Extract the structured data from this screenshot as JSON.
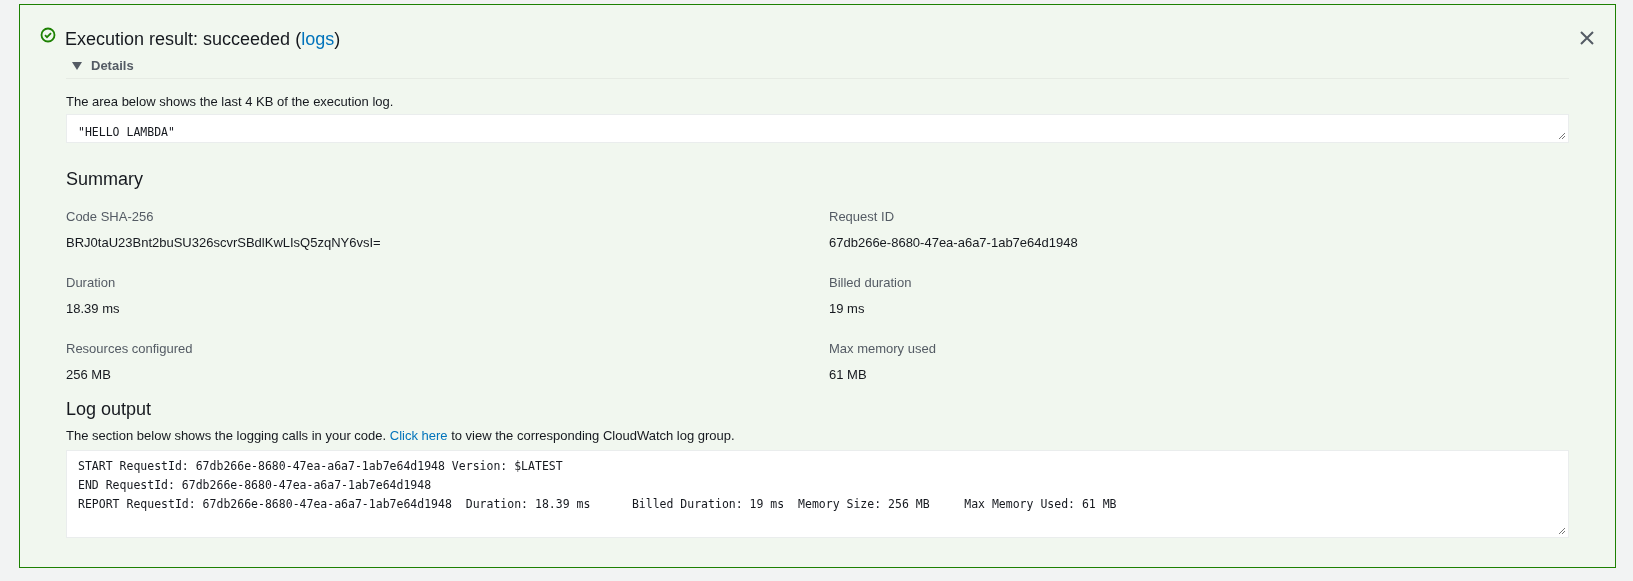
{
  "result": {
    "kind": "success",
    "title_prefix": "Execution result: succeeded (",
    "link": "logs",
    "title_suffix": ")"
  },
  "details": {
    "label": "Details",
    "expanded": true,
    "description": "The area below shows the last 4 KB of the execution log.",
    "output": "\"HELLO LAMBDA\""
  },
  "summary": {
    "heading": "Summary",
    "items": [
      {
        "label": "Code SHA-256",
        "value": "BRJ0taU23Bnt2buSU326scvrSBdlKwLIsQ5zqNY6vsI="
      },
      {
        "label": "Request ID",
        "value": "67db266e-8680-47ea-a6a7-1ab7e64d1948"
      },
      {
        "label": "Duration",
        "value": "18.39 ms"
      },
      {
        "label": "Billed duration",
        "value": "19 ms"
      },
      {
        "label": "Resources configured",
        "value": "256 MB"
      },
      {
        "label": "Max memory used",
        "value": "61 MB"
      }
    ]
  },
  "log_output": {
    "heading": "Log output",
    "description_before": "The section below shows the logging calls in your code.",
    "link": "Click here",
    "description_after": "to view the corresponding CloudWatch log group.",
    "lines": [
      "START RequestId: 67db266e-8680-47ea-a6a7-1ab7e64d1948 Version: $LATEST",
      "END RequestId: 67db266e-8680-47ea-a6a7-1ab7e64d1948",
      "REPORT RequestId: 67db266e-8680-47ea-a6a7-1ab7e64d1948  Duration: 18.39 ms      Billed Duration: 19 ms  Memory Size: 256 MB     Max Memory Used: 61 MB"
    ]
  }
}
